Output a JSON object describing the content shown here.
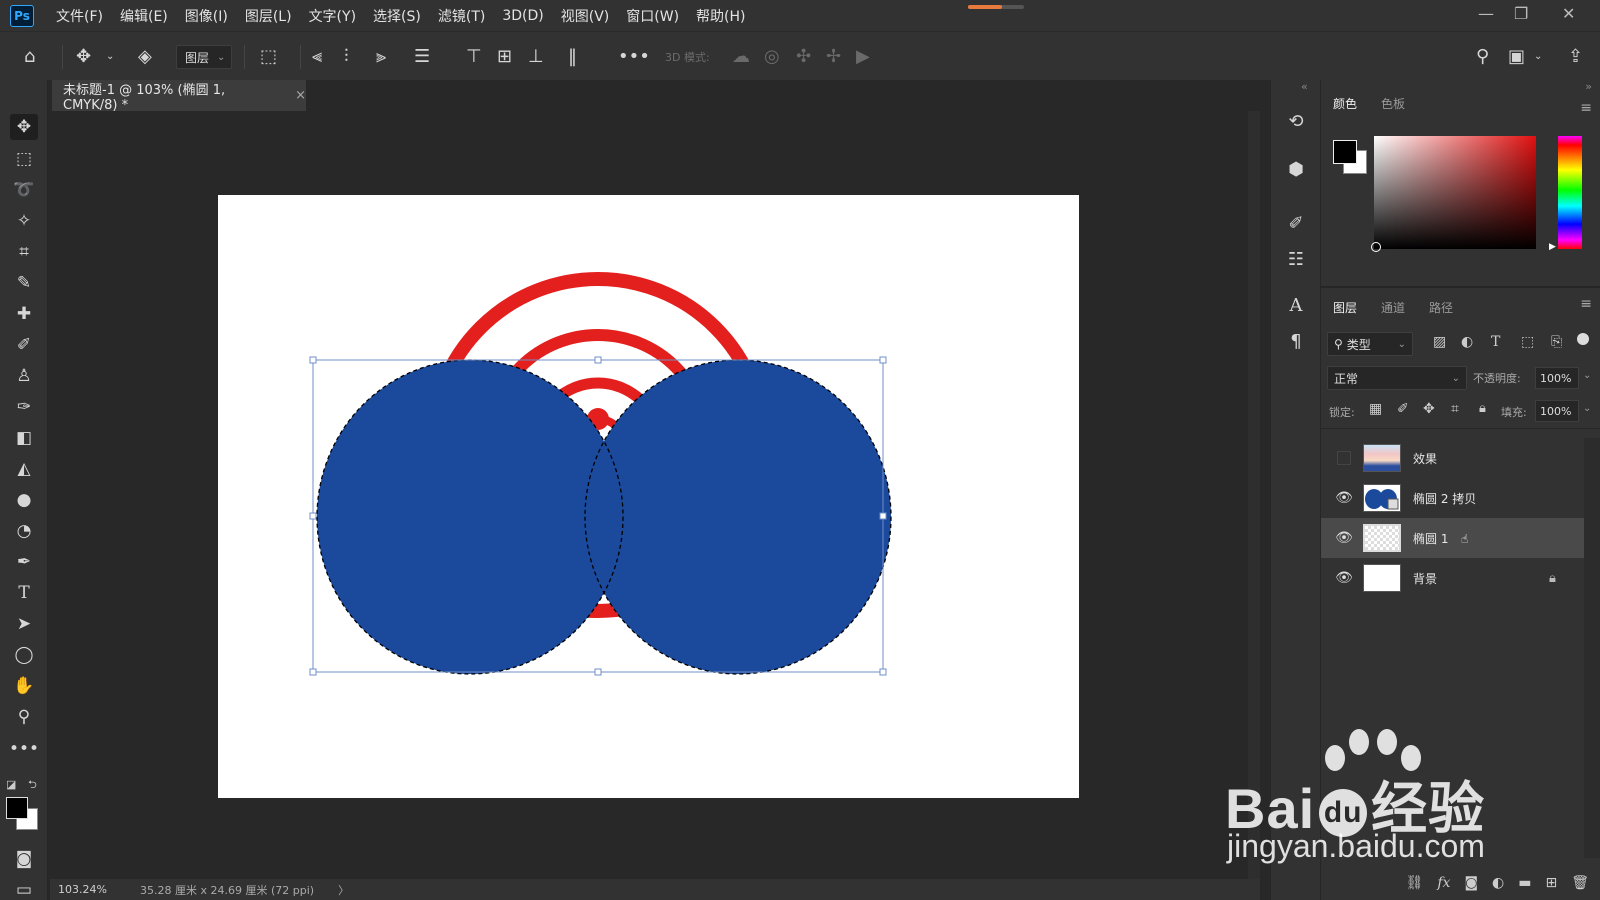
{
  "app": {
    "logo_text": "Ps"
  },
  "menu": [
    "文件(F)",
    "编辑(E)",
    "图像(I)",
    "图层(L)",
    "文字(Y)",
    "选择(S)",
    "滤镜(T)",
    "3D(D)",
    "视图(V)",
    "窗口(W)",
    "帮助(H)"
  ],
  "options_bar": {
    "auto_select_target": "图层",
    "mode_3d_label": "3D 模式:"
  },
  "document": {
    "tab_title": "未标题-1 @ 103% (椭圆 1, CMYK/8) *",
    "close_glyph": "×"
  },
  "status_bar": {
    "zoom": "103.24%",
    "doc_info": "35.28 厘米 x 24.69 厘米 (72 ppi)",
    "arrow": "〉"
  },
  "color_panel": {
    "tabs": [
      "颜色",
      "色板"
    ],
    "active_tab": 0,
    "foreground": "#000000",
    "background": "#ffffff"
  },
  "layers_panel": {
    "tabs": [
      "图层",
      "通道",
      "路径"
    ],
    "active_tab": 0,
    "filter_label": "类型",
    "blend_mode": "正常",
    "opacity_label": "不透明度:",
    "opacity_value": "100%",
    "lock_label": "锁定:",
    "fill_label": "填充:",
    "fill_value": "100%",
    "layers": [
      {
        "name": "效果",
        "visible": false,
        "selected": false,
        "locked": false
      },
      {
        "name": "椭圆 2 拷贝",
        "visible": true,
        "selected": false,
        "locked": false
      },
      {
        "name": "椭圆 1",
        "visible": true,
        "selected": true,
        "locked": false
      },
      {
        "name": "背景",
        "visible": true,
        "selected": false,
        "locked": true
      }
    ]
  },
  "artwork": {
    "arc_color": "#e3201d",
    "shape_color": "#1b4a9c"
  },
  "watermark": {
    "brand": "Bai",
    "brand_suffix": "经验",
    "url": "jingyan.baidu.com"
  }
}
